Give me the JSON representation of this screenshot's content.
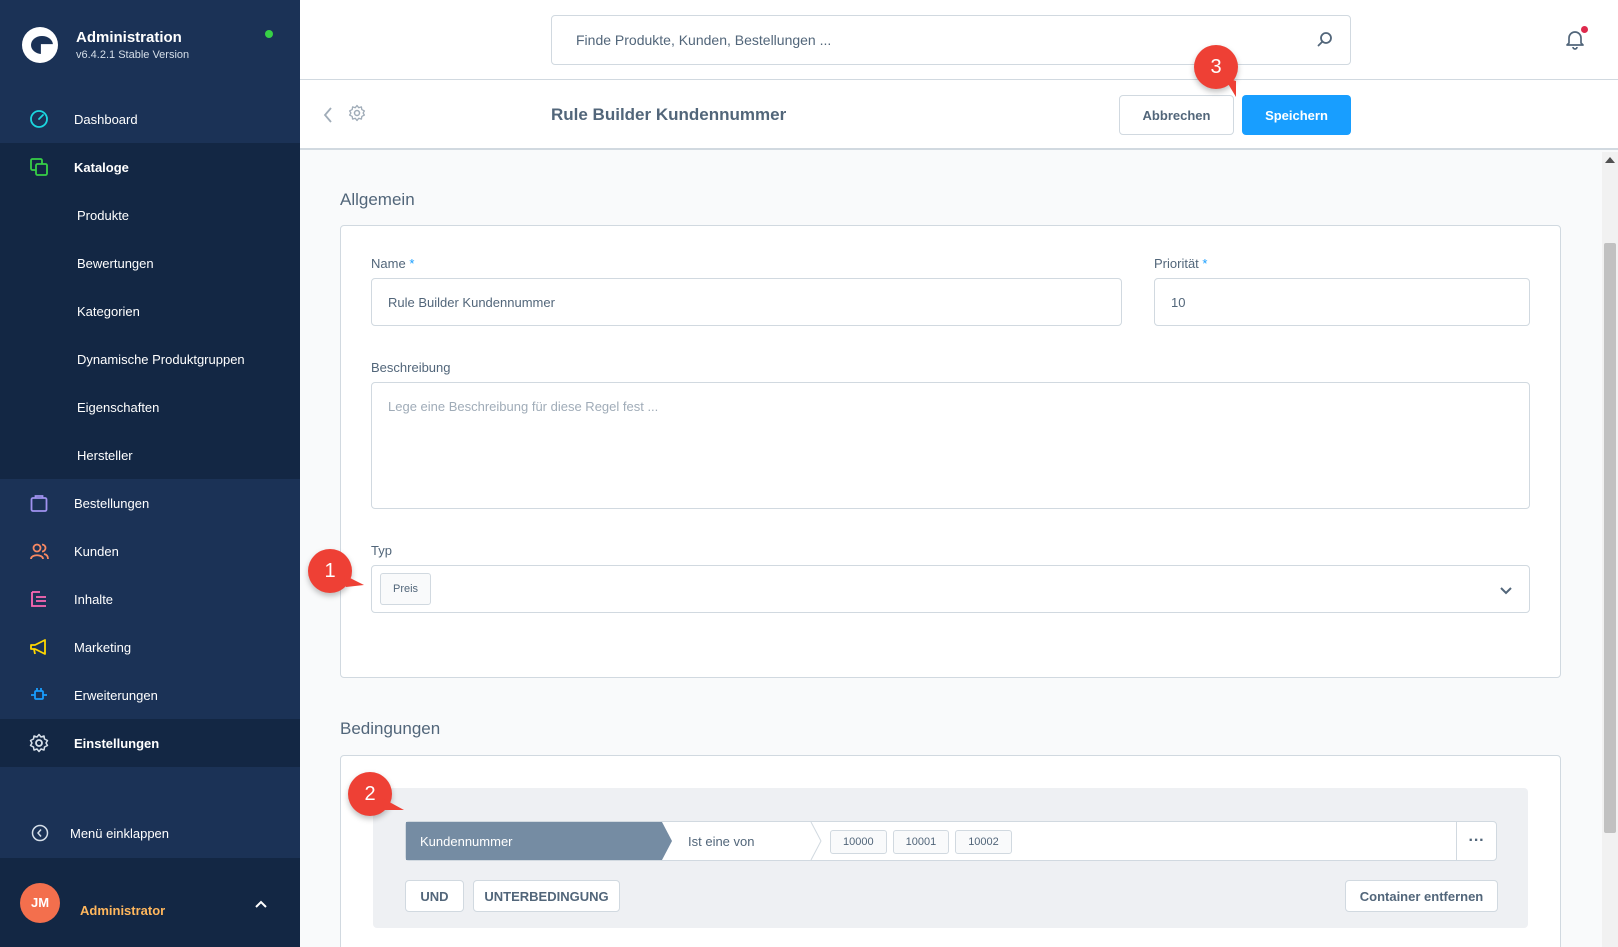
{
  "brand": {
    "title": "Administration",
    "version": "v6.4.2.1 Stable Version"
  },
  "nav": {
    "items": [
      {
        "label": "Dashboard"
      },
      {
        "label": "Kataloge"
      },
      {
        "label": "Bestellungen"
      },
      {
        "label": "Kunden"
      },
      {
        "label": "Inhalte"
      },
      {
        "label": "Marketing"
      },
      {
        "label": "Erweiterungen"
      },
      {
        "label": "Einstellungen"
      }
    ],
    "catalog_sub": [
      "Produkte",
      "Bewertungen",
      "Kategorien",
      "Dynamische Produktgruppen",
      "Eigenschaften",
      "Hersteller"
    ],
    "collapse_label": "Menü einklappen"
  },
  "user": {
    "initials": "JM",
    "name": "Administrator"
  },
  "search": {
    "placeholder": "Finde Produkte, Kunden, Bestellungen ..."
  },
  "smartbar": {
    "title": "Rule Builder Kundennummer",
    "cancel": "Abbrechen",
    "save": "Speichern"
  },
  "general": {
    "title": "Allgemein",
    "name_label": "Name",
    "name_value": "Rule Builder Kundennummer",
    "priority_label": "Priorität",
    "priority_value": "10",
    "required_mark": "*",
    "description_label": "Beschreibung",
    "description_placeholder": "Lege eine Beschreibung für diese Regel fest ...",
    "type_label": "Typ",
    "type_tag": "Preis"
  },
  "conditions": {
    "title": "Bedingungen",
    "field": "Kundennummer",
    "operator": "Ist eine von",
    "values": [
      "10000",
      "10001",
      "10002"
    ],
    "more": "···",
    "and_label": "UND",
    "sub_label": "UNTERBEDINGUNG",
    "remove_label": "Container entfernen"
  },
  "annotations": [
    "1",
    "2",
    "3"
  ],
  "colors": {
    "sidebar": "#1b3256",
    "primary": "#189eff",
    "badge": "#ee4035"
  }
}
